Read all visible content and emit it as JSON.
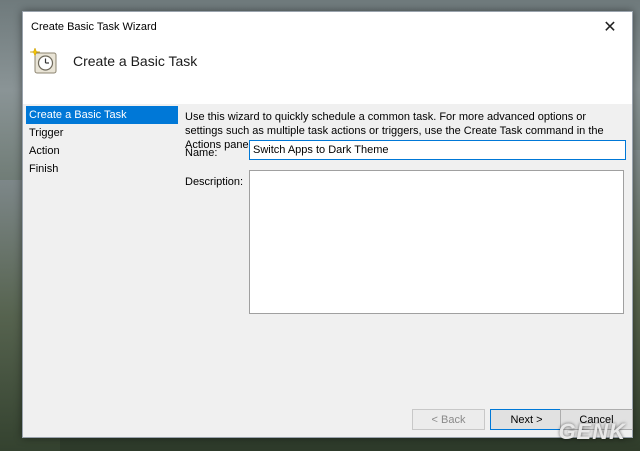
{
  "window": {
    "title": "Create Basic Task Wizard",
    "close_glyph": "✕"
  },
  "header": {
    "title": "Create a Basic Task",
    "icon": "task-scheduler-icon"
  },
  "steps": [
    {
      "label": "Create a Basic Task",
      "active": true
    },
    {
      "label": "Trigger"
    },
    {
      "label": "Action"
    },
    {
      "label": "Finish"
    }
  ],
  "main": {
    "description": "Use this wizard to quickly schedule a common task.  For more advanced options or settings such as multiple task actions or triggers, use the Create Task command in the Actions pane.",
    "name_label": "Name:",
    "name_value": "Switch Apps to Dark Theme",
    "description_label": "Description:",
    "description_value": ""
  },
  "buttons": {
    "back": "< Back",
    "next": "Next >",
    "cancel": "Cancel"
  },
  "watermark": "GENK",
  "colors": {
    "accent": "#0078d7",
    "panel": "#f0f0f0"
  }
}
